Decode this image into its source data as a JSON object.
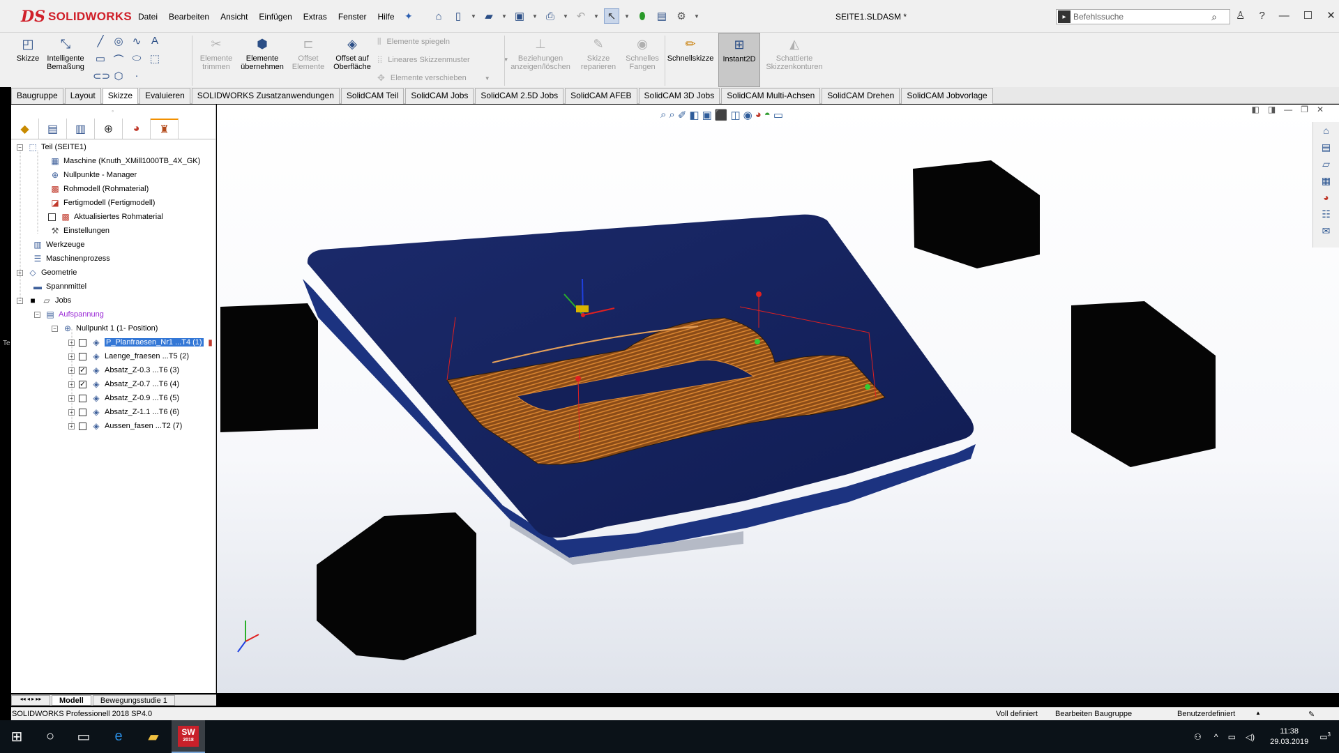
{
  "app": {
    "brand_prefix": "DS",
    "brand_name": "SOLIDWORKS",
    "document_title": "SEITE1.SLDASM *"
  },
  "menu": [
    "Datei",
    "Bearbeiten",
    "Ansicht",
    "Einfügen",
    "Extras",
    "Fenster",
    "Hilfe"
  ],
  "search": {
    "placeholder": "Befehlssuche"
  },
  "commands": {
    "skizze": "Skizze",
    "bemassung_1": "Intelligente",
    "bemassung_2": "Bemaßung",
    "trimmen_1": "Elemente",
    "trimmen_2": "trimmen",
    "uebernehmen_1": "Elemente",
    "uebernehmen_2": "übernehmen",
    "offset_1": "Offset",
    "offset_2": "Elemente",
    "offsetflaeche_1": "Offset auf",
    "offsetflaeche_2": "Oberfläche",
    "spiegeln": "Elemente spiegeln",
    "muster": "Lineares Skizzenmuster",
    "verschieben": "Elemente verschieben",
    "beziehungen_1": "Beziehungen",
    "beziehungen_2": "anzeigen/löschen",
    "reparieren_1": "Skizze",
    "reparieren_2": "reparieren",
    "fangen_1": "Schnelles",
    "fangen_2": "Fangen",
    "schnellskizze": "Schnellskizze",
    "instant2d": "Instant2D",
    "schattiert_1": "Schattierte",
    "schattiert_2": "Skizzenkonturen"
  },
  "tabs": [
    "Baugruppe",
    "Layout",
    "Skizze",
    "Evaluieren",
    "SOLIDWORKS Zusatzanwendungen",
    "SolidCAM Teil",
    "SolidCAM Jobs",
    "SolidCAM 2.5D Jobs",
    "SolidCAM AFEB",
    "SolidCAM 3D Jobs",
    "SolidCAM Multi-Achsen",
    "SolidCAM Drehen",
    "SolidCAM Jobvorlage"
  ],
  "active_tab": "Skizze",
  "tree": [
    {
      "label": "Teil (SEITE1)",
      "icon": "part-icon"
    },
    {
      "label": "Maschine (Knuth_XMill1000TB_4X_GK)",
      "icon": "machine-icon"
    },
    {
      "label": "Nullpunkte - Manager",
      "icon": "origin-icon"
    },
    {
      "label": "Rohmodell (Rohmaterial)",
      "icon": "stock-icon"
    },
    {
      "label": "Fertigmodell (Fertigmodell)",
      "icon": "target-icon"
    },
    {
      "label": "Aktualisiertes Rohmaterial",
      "icon": "updated-stock-icon"
    },
    {
      "label": "Einstellungen",
      "icon": "settings-icon"
    },
    {
      "label": "Werkzeuge",
      "icon": "tools-icon"
    },
    {
      "label": "Maschinenprozess",
      "icon": "process-icon"
    },
    {
      "label": "Geometrie",
      "icon": "geometry-icon"
    },
    {
      "label": "Spannmittel",
      "icon": "fixture-icon"
    },
    {
      "label": "Jobs",
      "icon": "folder-icon"
    },
    {
      "label": "Aufspannung",
      "icon": "setup-icon"
    },
    {
      "label": "Nullpunkt 1 (1- Position)",
      "icon": "origin-icon"
    },
    {
      "label": "P_Planfraesen_Nr1 ...T4 (1)",
      "icon": "operation-icon"
    },
    {
      "label": "Laenge_fraesen ...T5 (2)",
      "icon": "operation-icon"
    },
    {
      "label": "Absatz_Z-0.3 ...T6 (3)",
      "icon": "operation-icon"
    },
    {
      "label": "Absatz_Z-0.7 ...T6 (4)",
      "icon": "operation-icon"
    },
    {
      "label": "Absatz_Z-0.9 ...T6 (5)",
      "icon": "operation-icon"
    },
    {
      "label": "Absatz_Z-1.1 ...T6 (6)",
      "icon": "operation-icon"
    },
    {
      "label": "Aussen_fasen ...T2 (7)",
      "icon": "operation-icon"
    }
  ],
  "bottom_tabs": [
    "Modell",
    "Bewegungsstudie 1"
  ],
  "status": {
    "version": "SOLIDWORKS Professionell 2018 SP4.0",
    "defined": "Voll definiert",
    "editing": "Bearbeiten Baugruppe",
    "units": "Benutzerdefiniert"
  },
  "taskbar": {
    "time": "11:38",
    "date": "29.03.2019",
    "sw_badge": "2018",
    "notif_count": "3"
  },
  "side_clip_text": "Te",
  "colors": {
    "plate": "#14215a",
    "toolpath": "#c2732b",
    "brand": "#d0202a",
    "viewport_bg": "#ffffff"
  }
}
